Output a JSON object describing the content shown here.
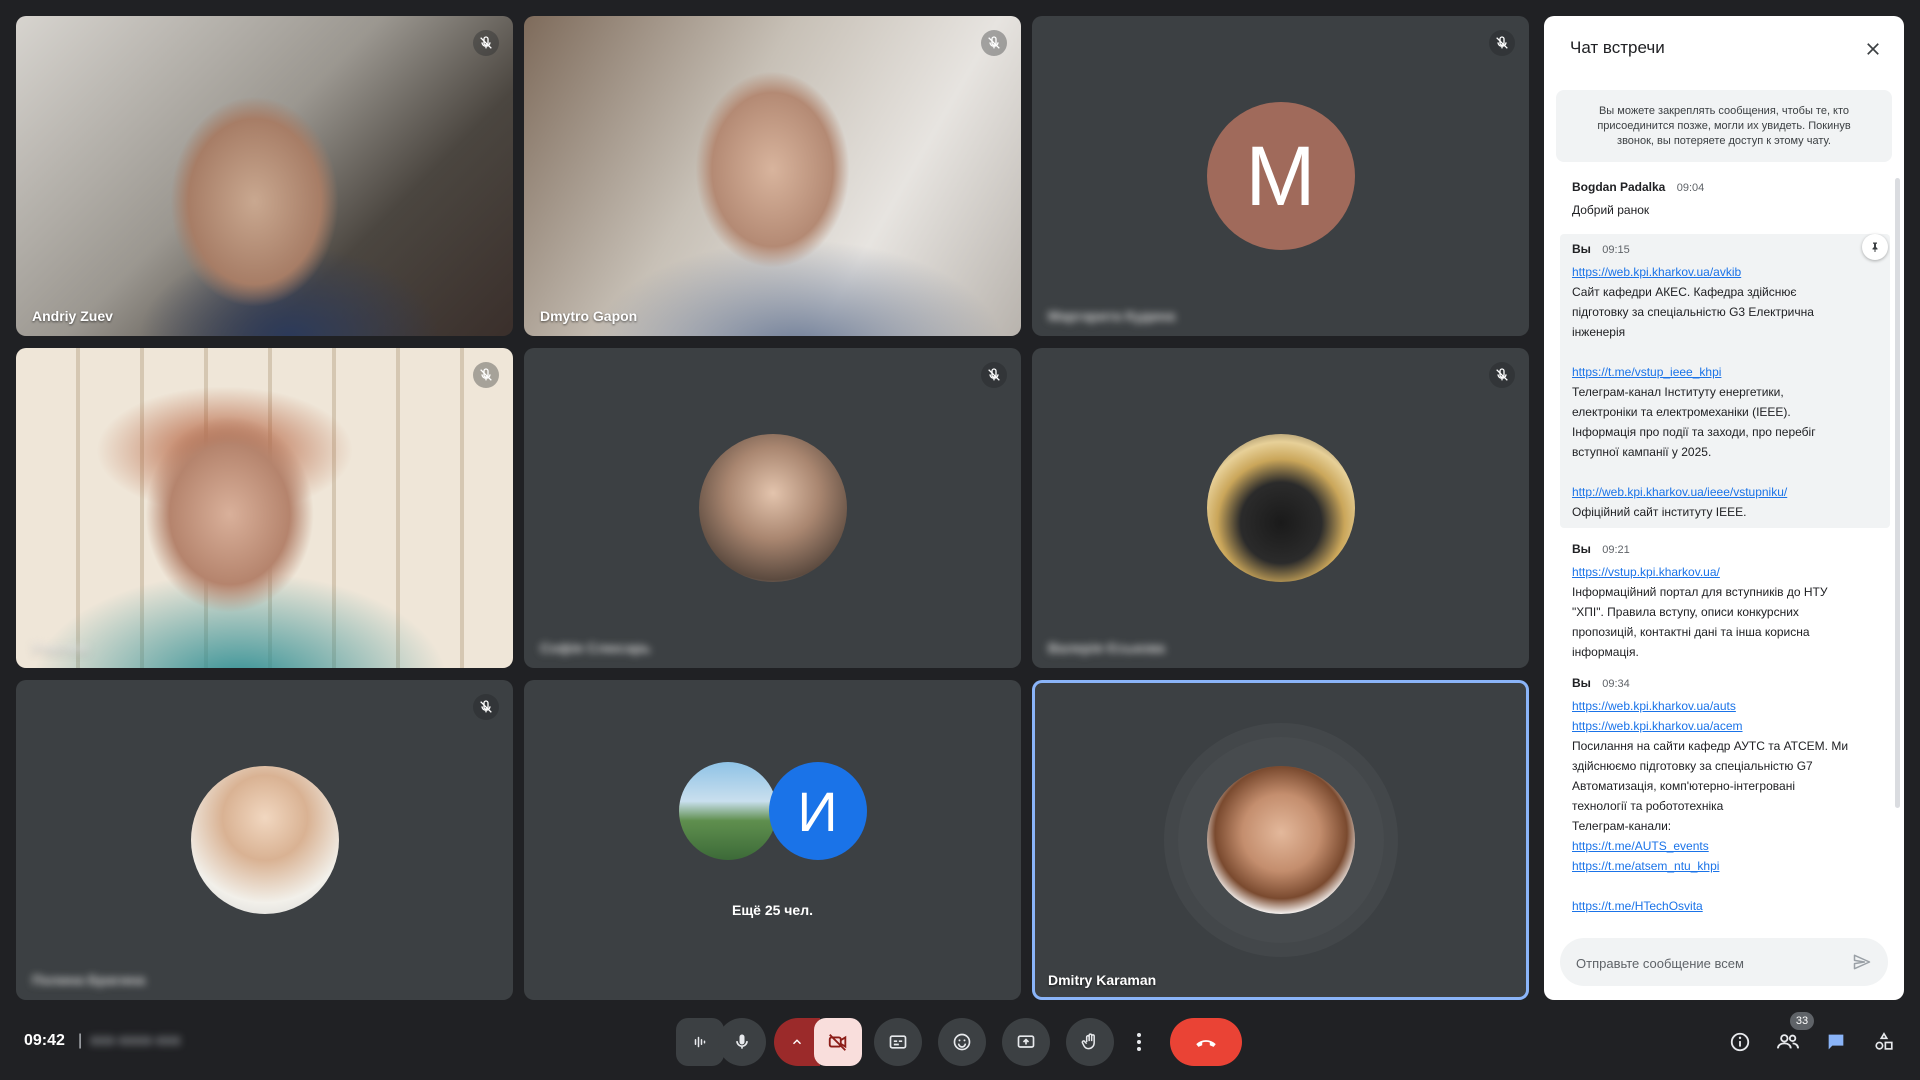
{
  "participants": [
    {
      "name": "Andriy Zuev",
      "muted": true
    },
    {
      "name": "Dmytro Gapon",
      "muted": true
    },
    {
      "name": "Маргарита Кудина",
      "muted": true,
      "avatar_letter": "М",
      "avatar_color": "#a06a5b"
    },
    {
      "name": "Учасник",
      "muted": true
    },
    {
      "name": "Софія Слюсарь",
      "muted": true
    },
    {
      "name": "Валерія Єськова",
      "muted": true
    },
    {
      "name": "Полина Брагина",
      "muted": true
    },
    {
      "more_letter": "И",
      "more_label": "Ещё 25 чел."
    },
    {
      "name": "Dmitry Karaman",
      "active": true
    }
  ],
  "chat": {
    "title": "Чат встречи",
    "info": "Вы можете закреплять сообщения, чтобы те, кто присоединится позже, могли их увидеть. Покинув звонок, вы потеряете доступ к этому чату.",
    "messages": [
      {
        "sender": "Bogdan Padalka",
        "time": "09:04",
        "lines": [
          "Добрий ранок"
        ]
      },
      {
        "sender": "Вы",
        "time": "09:15",
        "pinned": true,
        "link1": "https://web.kpi.kharkov.ua/avkib",
        "text1": [
          "Сайт кафедри АКЕС. Кафедра здійснює",
          "підготовку за спеціальністю G3 Електрична",
          "інженерія"
        ],
        "link2": "https://t.me/vstup_ieee_khpi",
        "text2": [
          "Телеграм-канал Інституту енергетики,",
          "електроніки та електромеханіки (IEEE).",
          "Інформація про події та заходи, про перебіг",
          "вступної кампанії у 2025."
        ],
        "link3": "http://web.kpi.kharkov.ua/ieee/vstupniku/",
        "text3": [
          "Офіційний сайт інституту IEEE."
        ]
      },
      {
        "sender": "Вы",
        "time": "09:21",
        "link1": "https://vstup.kpi.kharkov.ua/",
        "text1": [
          "Інформаційний портал для вступників до НТУ",
          "\"ХПІ\". Правила вступу, описи конкурсних",
          "пропозицій, контактні дані та інша корисна",
          "інформація."
        ]
      },
      {
        "sender": "Вы",
        "time": "09:34",
        "link1": "https://web.kpi.kharkov.ua/auts",
        "link2": "https://web.kpi.kharkov.ua/acem",
        "text1": [
          "Посилання на сайти кафедр АУТС та АТСЕМ. Ми",
          "здійснюємо підготовку за спеціальністю G7",
          "Автоматизація, комп'ютерно-інтегровані",
          "технології та робототехніка",
          "Телеграм-канали:"
        ],
        "link3": "https://t.me/AUTS_events",
        "link4": "https://t.me/atsem_ntu_khpi",
        "link5": "https://t.me/HTechOsvita"
      }
    ],
    "input_placeholder": "Отправьте сообщение всем"
  },
  "bottom_bar": {
    "time": "09:42",
    "separator": "|",
    "meeting_code": "xxx-xxxx-xxx",
    "participants_count": "33",
    "accent_red": "#ea4335"
  }
}
